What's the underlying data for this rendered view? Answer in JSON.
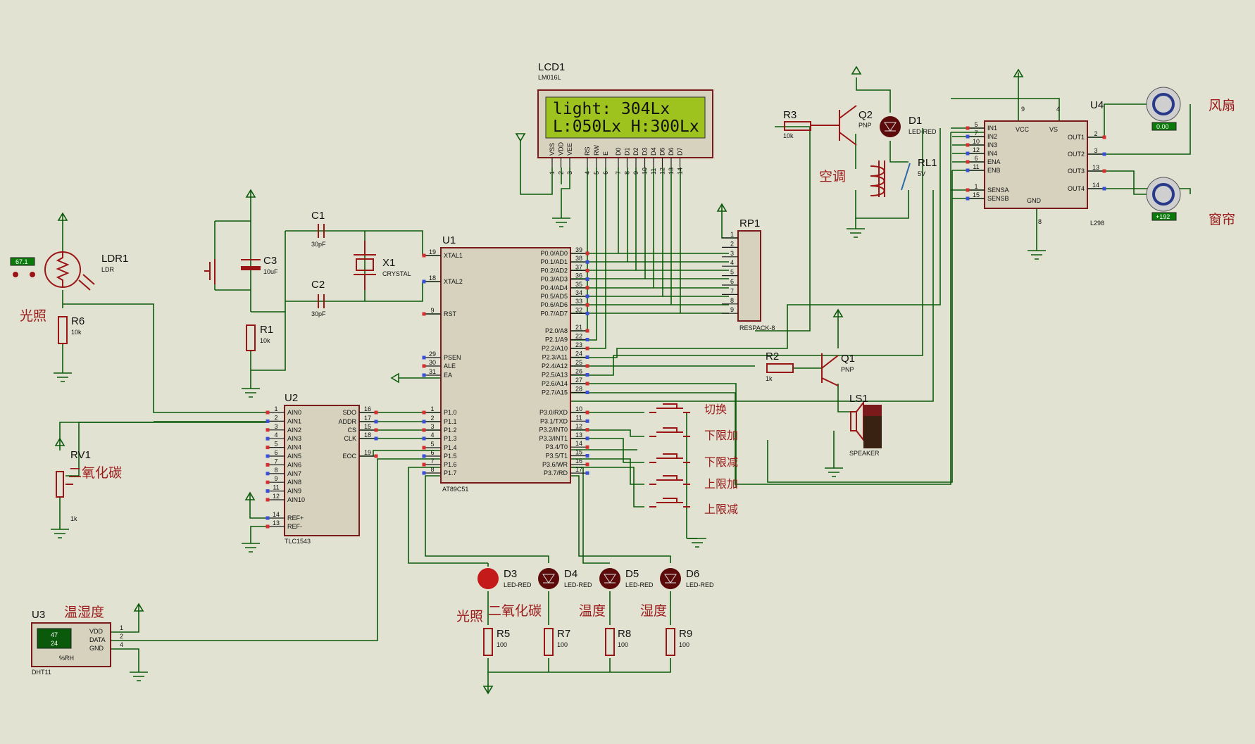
{
  "lcd": {
    "ref": "LCD1",
    "model": "LM016L",
    "line1": "light:  304Lx",
    "line2": "L:050Lx H:300Lx",
    "pins": [
      "VSS",
      "VDD",
      "VEE",
      "RS",
      "RW",
      "E",
      "D0",
      "D1",
      "D2",
      "D3",
      "D4",
      "D5",
      "D6",
      "D7"
    ],
    "pin_numbers": [
      "1",
      "2",
      "3",
      "4",
      "5",
      "6",
      "7",
      "8",
      "9",
      "10",
      "11",
      "12",
      "13",
      "14"
    ]
  },
  "mcu": {
    "ref": "U1",
    "model": "AT89C51",
    "left_pins": [
      {
        "num": "19",
        "name": "XTAL1"
      },
      {
        "num": "18",
        "name": "XTAL2"
      },
      {
        "num": "9",
        "name": "RST"
      },
      {
        "num": "29",
        "name": "PSEN"
      },
      {
        "num": "30",
        "name": "ALE"
      },
      {
        "num": "31",
        "name": "EA"
      },
      {
        "num": "1",
        "name": "P1.0"
      },
      {
        "num": "2",
        "name": "P1.1"
      },
      {
        "num": "3",
        "name": "P1.2"
      },
      {
        "num": "4",
        "name": "P1.3"
      },
      {
        "num": "5",
        "name": "P1.4"
      },
      {
        "num": "6",
        "name": "P1.5"
      },
      {
        "num": "7",
        "name": "P1.6"
      },
      {
        "num": "8",
        "name": "P1.7"
      }
    ],
    "right_pins": [
      {
        "num": "39",
        "name": "P0.0/AD0"
      },
      {
        "num": "38",
        "name": "P0.1/AD1"
      },
      {
        "num": "37",
        "name": "P0.2/AD2"
      },
      {
        "num": "36",
        "name": "P0.3/AD3"
      },
      {
        "num": "35",
        "name": "P0.4/AD4"
      },
      {
        "num": "34",
        "name": "P0.5/AD5"
      },
      {
        "num": "33",
        "name": "P0.6/AD6"
      },
      {
        "num": "32",
        "name": "P0.7/AD7"
      },
      {
        "num": "21",
        "name": "P2.0/A8"
      },
      {
        "num": "22",
        "name": "P2.1/A9"
      },
      {
        "num": "23",
        "name": "P2.2/A10"
      },
      {
        "num": "24",
        "name": "P2.3/A11"
      },
      {
        "num": "25",
        "name": "P2.4/A12"
      },
      {
        "num": "26",
        "name": "P2.5/A13"
      },
      {
        "num": "27",
        "name": "P2.6/A14"
      },
      {
        "num": "28",
        "name": "P2.7/A15"
      },
      {
        "num": "10",
        "name": "P3.0/RXD"
      },
      {
        "num": "11",
        "name": "P3.1/TXD"
      },
      {
        "num": "12",
        "name": "P3.2/INT0"
      },
      {
        "num": "13",
        "name": "P3.3/INT1"
      },
      {
        "num": "14",
        "name": "P3.4/T0"
      },
      {
        "num": "15",
        "name": "P3.5/T1"
      },
      {
        "num": "16",
        "name": "P3.6/WR"
      },
      {
        "num": "17",
        "name": "P3.7/RD"
      }
    ]
  },
  "adc": {
    "ref": "U2",
    "model": "TLC1543",
    "left_pins": [
      {
        "num": "1",
        "name": "AIN0"
      },
      {
        "num": "2",
        "name": "AIN1"
      },
      {
        "num": "3",
        "name": "AIN2"
      },
      {
        "num": "4",
        "name": "AIN3"
      },
      {
        "num": "5",
        "name": "AIN4"
      },
      {
        "num": "6",
        "name": "AIN5"
      },
      {
        "num": "7",
        "name": "AIN6"
      },
      {
        "num": "8",
        "name": "AIN7"
      },
      {
        "num": "9",
        "name": "AIN8"
      },
      {
        "num": "11",
        "name": "AIN9"
      },
      {
        "num": "12",
        "name": "AIN10"
      },
      {
        "num": "14",
        "name": "REF+"
      },
      {
        "num": "13",
        "name": "REF-"
      }
    ],
    "right_pins": [
      {
        "num": "16",
        "name": "SDO"
      },
      {
        "num": "17",
        "name": "ADDR"
      },
      {
        "num": "15",
        "name": "CS"
      },
      {
        "num": "18",
        "name": "CLK"
      },
      {
        "num": "19",
        "name": "EOC"
      }
    ]
  },
  "driver": {
    "ref": "U4",
    "model": "L298",
    "left_pins": [
      {
        "num": "5",
        "name": "IN1"
      },
      {
        "num": "7",
        "name": "IN2"
      },
      {
        "num": "10",
        "name": "IN3"
      },
      {
        "num": "12",
        "name": "IN4"
      },
      {
        "num": "6",
        "name": "ENA"
      },
      {
        "num": "11",
        "name": "ENB"
      },
      {
        "num": "1",
        "name": "SENSA"
      },
      {
        "num": "15",
        "name": "SENSB"
      }
    ],
    "right_pins": [
      {
        "num": "2",
        "name": "OUT1"
      },
      {
        "num": "3",
        "name": "OUT2"
      },
      {
        "num": "13",
        "name": "OUT3"
      },
      {
        "num": "14",
        "name": "OUT4"
      }
    ],
    "top_pins": [
      {
        "num": "9",
        "name": "VCC"
      },
      {
        "num": "4",
        "name": "VS"
      }
    ],
    "bottom_pins": [
      {
        "num": "8",
        "name": "GND"
      }
    ]
  },
  "dht": {
    "ref": "U3",
    "model": "DHT11",
    "hum": "47",
    "temp": "24",
    "unit": "%RH",
    "pins": [
      "VDD",
      "DATA",
      "GND"
    ],
    "pin_numbers": [
      "1",
      "2",
      "4"
    ]
  },
  "rpack": {
    "ref": "RP1",
    "model": "RESPACK-8",
    "pins": [
      "1",
      "2",
      "3",
      "4",
      "5",
      "6",
      "7",
      "8",
      "9"
    ]
  },
  "components": {
    "c1": {
      "ref": "C1",
      "value": "30pF"
    },
    "c2": {
      "ref": "C2",
      "value": "30pF"
    },
    "c3": {
      "ref": "C3",
      "value": "10uF"
    },
    "x1": {
      "ref": "X1",
      "value": "CRYSTAL"
    },
    "r1": {
      "ref": "R1",
      "value": "10k"
    },
    "r2": {
      "ref": "R2",
      "value": "1k"
    },
    "r3": {
      "ref": "R3",
      "value": "10k"
    },
    "r5": {
      "ref": "R5",
      "value": "100"
    },
    "r6": {
      "ref": "R6",
      "value": "10k"
    },
    "r7": {
      "ref": "R7",
      "value": "100"
    },
    "r8": {
      "ref": "R8",
      "value": "100"
    },
    "r9": {
      "ref": "R9",
      "value": "100"
    },
    "rv1": {
      "ref": "RV1",
      "value": "1k"
    },
    "ldr1": {
      "ref": "LDR1",
      "value": "LDR",
      "reading": "67.1"
    },
    "q1": {
      "ref": "Q1",
      "value": "PNP"
    },
    "q2": {
      "ref": "Q2",
      "value": "PNP"
    },
    "d1": {
      "ref": "D1",
      "value": "LED-RED"
    },
    "d3": {
      "ref": "D3",
      "value": "LED-RED"
    },
    "d4": {
      "ref": "D4",
      "value": "LED-RED"
    },
    "d5": {
      "ref": "D5",
      "value": "LED-RED"
    },
    "d6": {
      "ref": "D6",
      "value": "LED-RED"
    },
    "rl1": {
      "ref": "RL1",
      "value": "5V"
    },
    "ls1": {
      "ref": "LS1",
      "value": "SPEAKER"
    },
    "motor_fan": {
      "reading": "0.00"
    },
    "motor_curtain": {
      "reading": "+192"
    }
  },
  "labels": {
    "light": "光照",
    "co2": "二氧化碳",
    "temp_hum": "温湿度",
    "aircon": "空调",
    "fan": "风扇",
    "curtain": "窗帘",
    "temperature": "温度",
    "humidity": "湿度",
    "switch": "切换",
    "lower_up": "下限加",
    "lower_down": "下限减",
    "upper_up": "上限加",
    "upper_down": "上限减"
  },
  "colors": {
    "wire": "#0b5a0b",
    "body": "#7a1a1a",
    "lcd_screen": "#9ec31e",
    "background": "#e2e2d2",
    "label": "#9b1b1b"
  }
}
